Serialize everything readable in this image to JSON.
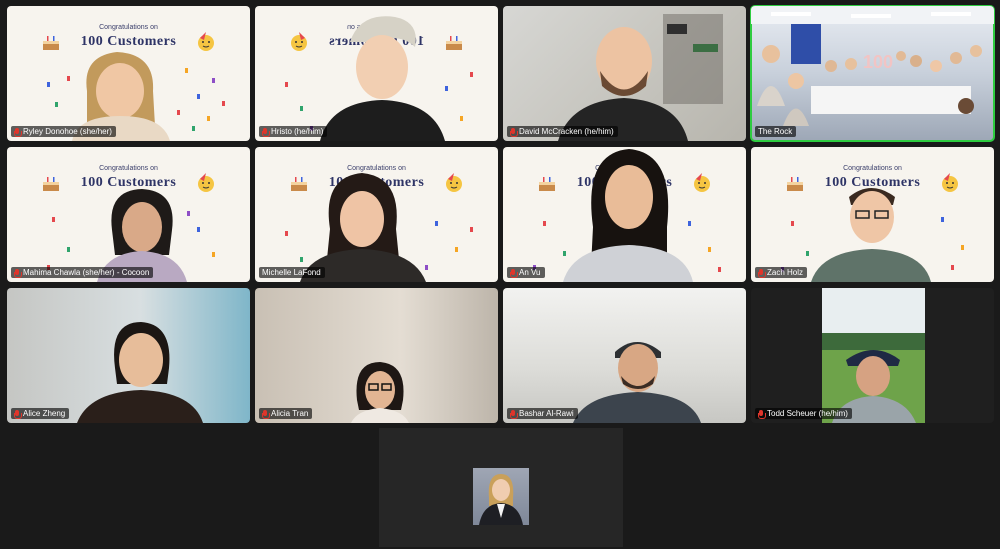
{
  "congrats": {
    "line1": "Congratulations on",
    "line2": "100 Customers"
  },
  "participants": [
    {
      "name": "Ryley Donohoe (she/her)",
      "muted": true,
      "background": "congrats"
    },
    {
      "name": "Hristo (he/him)",
      "muted": true,
      "background": "congrats-mirrored"
    },
    {
      "name": "David McCracken (he/him)",
      "muted": true,
      "background": "room"
    },
    {
      "name": "The Rock",
      "muted": false,
      "background": "office",
      "active_speaker": true
    },
    {
      "name": "Mahima Chawla (she/her) - Cocoon",
      "muted": true,
      "background": "congrats"
    },
    {
      "name": "Michelle LaFond",
      "muted": false,
      "background": "congrats"
    },
    {
      "name": "An Vu",
      "muted": true,
      "background": "congrats"
    },
    {
      "name": "Zach Holz",
      "muted": true,
      "background": "congrats"
    },
    {
      "name": "Alice Zheng",
      "muted": true,
      "background": "blue-room"
    },
    {
      "name": "Alicia Tran",
      "muted": true,
      "background": "warm-room"
    },
    {
      "name": "Bashar Al-Rawi",
      "muted": true,
      "background": "light-room"
    },
    {
      "name": "Todd Scheuer (he/him)",
      "muted": true,
      "background": "outdoor"
    }
  ],
  "office_sign": "100",
  "colors": {
    "app_background": "#1a1a1a",
    "active_speaker_border": "#2ecc40",
    "muted_icon": "#e0352b",
    "banner_text": "#2e3466"
  }
}
